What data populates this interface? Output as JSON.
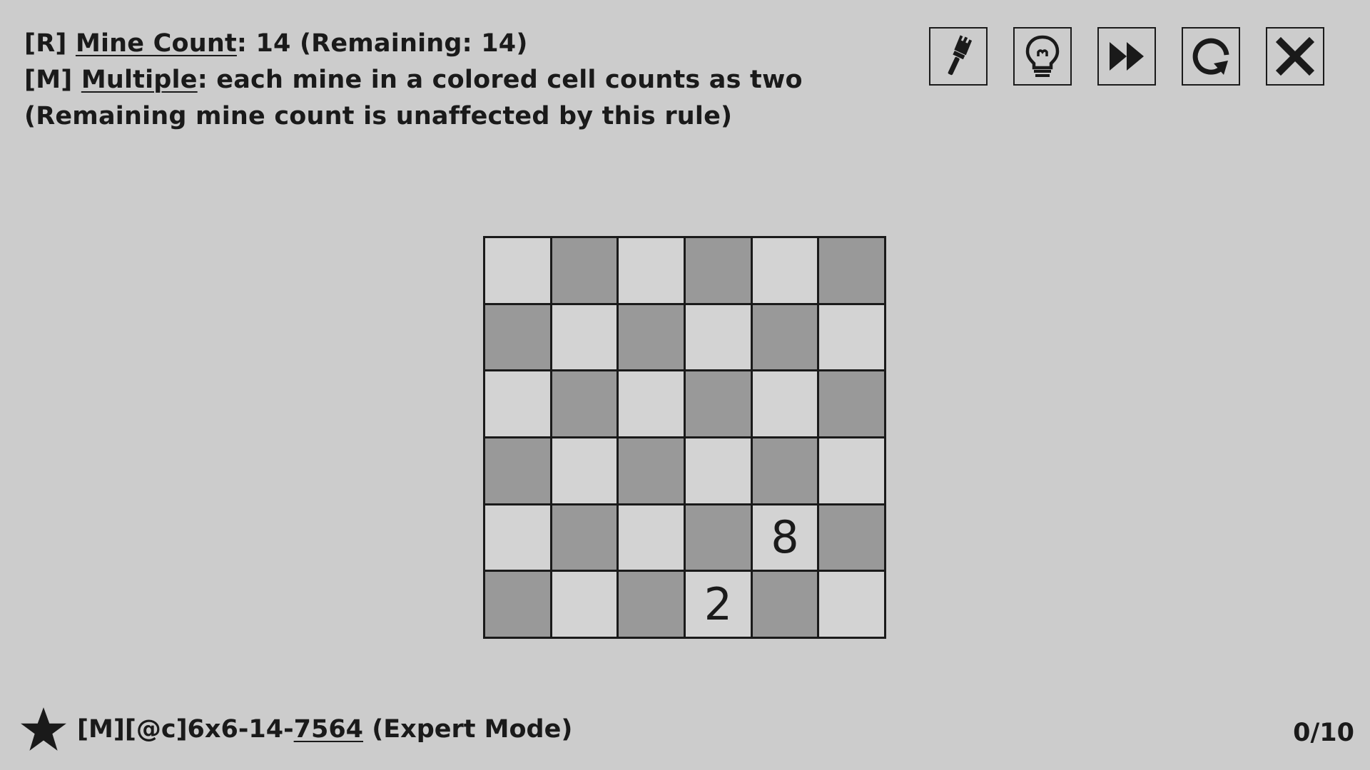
{
  "rules": {
    "mine_count": {
      "prefix": "[R] ",
      "link": "Mine Count",
      "suffix": ":  14 (Remaining: 14)"
    },
    "multiple": {
      "prefix": "[M] ",
      "link": "Multiple",
      "suffix": ": each mine in a colored cell counts as two"
    },
    "note": "(Remaining mine count is unaffected by this rule)"
  },
  "toolbar": {
    "buttons": [
      {
        "name": "paint-brush",
        "icon": "brush-icon"
      },
      {
        "name": "hint",
        "icon": "lightbulb-icon"
      },
      {
        "name": "fast-forward",
        "icon": "fast-forward-icon"
      },
      {
        "name": "restart",
        "icon": "restart-icon"
      },
      {
        "name": "close",
        "icon": "close-icon"
      }
    ]
  },
  "board": {
    "rows": 6,
    "cols": 6,
    "cells": [
      [
        "",
        "",
        "",
        "",
        "",
        ""
      ],
      [
        "",
        "",
        "",
        "",
        "",
        ""
      ],
      [
        "",
        "",
        "",
        "",
        "",
        ""
      ],
      [
        "",
        "",
        "",
        "",
        "",
        ""
      ],
      [
        "",
        "",
        "",
        "",
        "8",
        ""
      ],
      [
        "",
        "",
        "",
        "2",
        "",
        ""
      ]
    ],
    "colors": {
      "light": "#d3d3d3",
      "dark": "#999999"
    }
  },
  "footer": {
    "star_icon": "star-icon",
    "puzzle_prefix": "[M][@c]6x6-14-",
    "puzzle_seed": "7564",
    "puzzle_suffix": " (Expert Mode)",
    "progress": "0/10"
  }
}
